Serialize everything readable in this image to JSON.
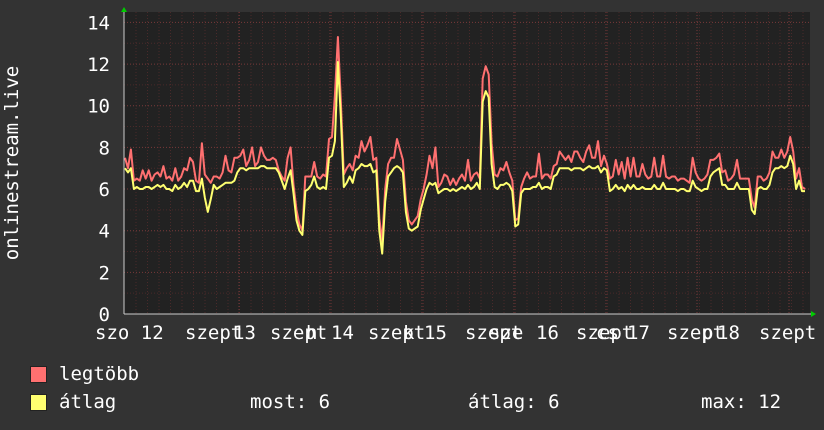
{
  "chart_data": {
    "type": "line",
    "ylabel": "onlinestream.live",
    "ylim": [
      0,
      14.5
    ],
    "yticks": [
      0,
      2,
      4,
      6,
      8,
      10,
      12,
      14
    ],
    "xlabels": [
      "szo 12",
      "szept",
      "13",
      "szept",
      "h",
      "14",
      "szept",
      "k",
      "15",
      "szept",
      "sze",
      "16",
      "szept",
      "cs",
      "17",
      "szept",
      "p",
      "18",
      "szept"
    ],
    "grid": true,
    "colors": {
      "max": "#ff7070",
      "avg": "#ffff70",
      "background": "#333333",
      "plot": "#222222",
      "grid": "#7a3a3a"
    },
    "series": [
      {
        "name": "legtöbb",
        "values": [
          7.5,
          7.0,
          7.9,
          6.4,
          6.5,
          6.4,
          6.9,
          6.5,
          6.9,
          6.4,
          6.7,
          6.8,
          6.6,
          7.1,
          6.5,
          6.6,
          6.4,
          7.0,
          6.4,
          6.6,
          7.0,
          6.9,
          7.5,
          7.3,
          6.4,
          6.3,
          8.2,
          6.7,
          6.5,
          6.3,
          6.6,
          6.6,
          6.5,
          6.8,
          7.6,
          6.9,
          6.8,
          7.5,
          7.5,
          7.6,
          7.9,
          7.1,
          7.4,
          8.0,
          7.1,
          7.3,
          8.0,
          7.6,
          7.4,
          7.4,
          7.5,
          7.4,
          6.9,
          6.6,
          6.4,
          7.5,
          8.0,
          6.2,
          5.0,
          4.3,
          4.0,
          6.6,
          6.6,
          6.6,
          7.3,
          6.6,
          6.5,
          6.7,
          6.6,
          8.4,
          8.5,
          10.5,
          13.3,
          10.3,
          6.7,
          7.0,
          7.2,
          6.9,
          7.6,
          7.5,
          8.3,
          7.8,
          8.1,
          8.5,
          7.4,
          7.5,
          4.6,
          3.5,
          6.0,
          7.2,
          7.5,
          7.5,
          8.4,
          7.9,
          7.4,
          5.4,
          4.5,
          4.3,
          4.5,
          4.7,
          5.5,
          6.0,
          6.7,
          7.6,
          7.0,
          8.0,
          6.1,
          6.3,
          6.7,
          6.6,
          6.2,
          6.5,
          6.2,
          6.5,
          6.7,
          6.4,
          7.4,
          6.4,
          6.7,
          6.8,
          6.5,
          11.3,
          11.9,
          11.5,
          8.2,
          6.7,
          6.6,
          7.0,
          6.9,
          7.3,
          6.8,
          6.4,
          4.5,
          4.6,
          6.1,
          6.5,
          6.8,
          6.5,
          6.6,
          6.6,
          7.7,
          6.5,
          6.7,
          6.7,
          6.5,
          7.1,
          7.2,
          7.8,
          7.6,
          7.4,
          7.6,
          7.3,
          7.8,
          7.8,
          7.5,
          7.3,
          7.8,
          8.1,
          7.5,
          7.5,
          8.3,
          7.1,
          7.6,
          7.2,
          6.5,
          6.6,
          7.4,
          6.7,
          7.3,
          6.5,
          7.5,
          6.6,
          7.5,
          6.6,
          6.6,
          7.2,
          6.7,
          6.5,
          6.6,
          7.5,
          6.6,
          6.6,
          7.6,
          6.6,
          6.5,
          6.6,
          6.6,
          6.4,
          6.5,
          6.5,
          6.4,
          6.3,
          7.5,
          6.8,
          6.5,
          6.4,
          6.5,
          6.7,
          7.4,
          7.4,
          7.5,
          7.7,
          6.8,
          6.9,
          6.4,
          6.5,
          6.7,
          7.4,
          6.5,
          6.5,
          6.5,
          6.5,
          5.5,
          5.1,
          6.6,
          6.6,
          6.4,
          6.5,
          6.8,
          7.8,
          7.5,
          7.5,
          7.9,
          7.5,
          7.8,
          8.5,
          7.8,
          6.5,
          7.0,
          6.1,
          6.0
        ],
        "color": "#ff7070"
      },
      {
        "name": "átlag",
        "values": [
          7.0,
          6.8,
          7.0,
          6.0,
          6.1,
          6.0,
          6.0,
          6.1,
          6.1,
          6.0,
          6.1,
          6.2,
          6.1,
          6.2,
          6.0,
          6.0,
          5.9,
          6.2,
          6.0,
          6.1,
          6.3,
          6.1,
          6.4,
          6.4,
          5.9,
          5.9,
          6.5,
          5.6,
          4.9,
          5.5,
          6.2,
          6.0,
          6.1,
          6.2,
          6.3,
          6.3,
          6.3,
          6.4,
          6.8,
          7.0,
          7.0,
          6.9,
          7.0,
          7.0,
          7.0,
          7.0,
          7.1,
          7.1,
          7.0,
          7.0,
          7.0,
          7.0,
          6.8,
          6.4,
          6.0,
          6.5,
          6.9,
          5.8,
          4.5,
          4.0,
          3.8,
          5.9,
          6.0,
          6.2,
          6.6,
          6.1,
          6.0,
          6.1,
          6.0,
          7.5,
          7.6,
          8.3,
          12.1,
          9.5,
          6.1,
          6.3,
          6.6,
          6.3,
          6.9,
          7.0,
          7.2,
          7.1,
          7.1,
          7.2,
          6.8,
          6.9,
          4.0,
          2.9,
          5.4,
          6.6,
          6.8,
          7.0,
          7.1,
          7.0,
          6.8,
          4.9,
          4.1,
          4.0,
          4.1,
          4.2,
          5.0,
          5.5,
          6.0,
          6.3,
          6.2,
          6.3,
          5.8,
          5.9,
          6.0,
          6.0,
          5.9,
          6.0,
          5.9,
          6.0,
          6.1,
          6.0,
          6.2,
          6.0,
          6.1,
          6.3,
          6.0,
          10.2,
          10.7,
          10.4,
          7.2,
          6.1,
          6.0,
          6.2,
          6.2,
          6.3,
          6.2,
          5.9,
          4.2,
          4.3,
          5.8,
          6.0,
          6.0,
          6.0,
          6.1,
          6.1,
          6.3,
          6.0,
          6.1,
          6.1,
          6.0,
          6.6,
          6.7,
          7.0,
          7.0,
          7.0,
          7.0,
          6.9,
          7.0,
          7.0,
          7.0,
          6.9,
          7.0,
          7.1,
          7.0,
          7.0,
          7.1,
          6.8,
          7.0,
          6.9,
          5.9,
          6.0,
          6.2,
          6.0,
          6.1,
          5.9,
          6.2,
          6.0,
          6.2,
          6.0,
          6.0,
          6.1,
          6.0,
          6.0,
          6.0,
          6.2,
          6.0,
          6.0,
          6.3,
          6.0,
          6.0,
          6.0,
          6.0,
          5.9,
          6.0,
          6.0,
          5.9,
          5.9,
          6.4,
          6.1,
          6.0,
          5.9,
          6.0,
          6.0,
          6.6,
          6.8,
          6.9,
          7.0,
          6.2,
          6.2,
          6.0,
          6.0,
          6.0,
          6.3,
          6.0,
          6.0,
          6.0,
          6.0,
          5.0,
          4.8,
          6.0,
          6.1,
          6.0,
          6.0,
          6.2,
          6.8,
          7.0,
          7.0,
          7.1,
          7.0,
          7.1,
          7.6,
          7.2,
          6.0,
          6.4,
          5.9,
          5.9
        ],
        "color": "#ffff70"
      }
    ]
  },
  "legend": [
    {
      "label": "legtöbb",
      "color": "#ff7070"
    },
    {
      "label": "átlag",
      "color": "#ffff70"
    }
  ],
  "stats": {
    "current": "most: 6",
    "average": "átlag: 6",
    "max": "max: 12"
  }
}
